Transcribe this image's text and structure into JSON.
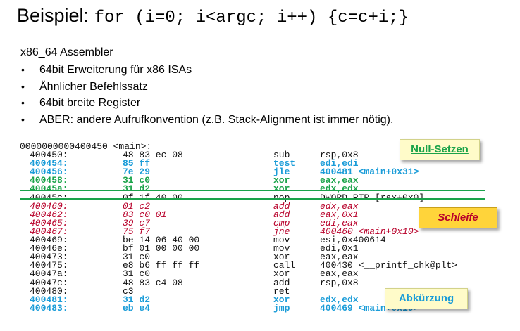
{
  "title": {
    "prefix": "Beispiel:",
    "code": "for (i=0; i<argc; i++) {c=c+i;}"
  },
  "subtitle": "x86_64 Assembler",
  "bullets": [
    "64bit Erweiterung für x86 ISAs",
    "Ähnlicher Befehlssatz",
    "64bit breite Register",
    "ABER: andere Aufrufkonvention (z.B. Stack-Alignment ist immer nötig),"
  ],
  "bullet_glyph": "•",
  "listing": {
    "header": "0000000000400450 <main>:",
    "rows": [
      {
        "addr": "400450:",
        "bytes": "48 83 ec 08",
        "mnemonic": "sub",
        "operands": "rsp,0x8",
        "style": "black"
      },
      {
        "addr": "400454:",
        "bytes": "85 ff",
        "mnemonic": "test",
        "operands": "edi,edi",
        "style": "blue"
      },
      {
        "addr": "400456:",
        "bytes": "7e 29",
        "mnemonic": "jle",
        "operands": "400481 <main+0x31>",
        "style": "blue"
      },
      {
        "addr": "400458:",
        "bytes": "31 c0",
        "mnemonic": "xor",
        "operands": "eax,eax",
        "style": "green"
      },
      {
        "addr": "40045a:",
        "bytes": "31 d2",
        "mnemonic": "xor",
        "operands": "edx,edx",
        "style": "green"
      },
      {
        "addr": "40045c:",
        "bytes": "0f 1f 40 00",
        "mnemonic": "nop",
        "operands": "DWORD PTR [rax+0x0]",
        "style": "black"
      },
      {
        "addr": "400460:",
        "bytes": "01 c2",
        "mnemonic": "add",
        "operands": "edx,eax",
        "style": "red"
      },
      {
        "addr": "400462:",
        "bytes": "83 c0 01",
        "mnemonic": "add",
        "operands": "eax,0x1",
        "style": "red"
      },
      {
        "addr": "400465:",
        "bytes": "39 c7",
        "mnemonic": "cmp",
        "operands": "edi,eax",
        "style": "red"
      },
      {
        "addr": "400467:",
        "bytes": "75 f7",
        "mnemonic": "jne",
        "operands": "400460 <main+0x10>",
        "style": "red"
      },
      {
        "addr": "400469:",
        "bytes": "be 14 06 40 00",
        "mnemonic": "mov",
        "operands": "esi,0x400614",
        "style": "black"
      },
      {
        "addr": "40046e:",
        "bytes": "bf 01 00 00 00",
        "mnemonic": "mov",
        "operands": "edi,0x1",
        "style": "black"
      },
      {
        "addr": "400473:",
        "bytes": "31 c0",
        "mnemonic": "xor",
        "operands": "eax,eax",
        "style": "black"
      },
      {
        "addr": "400475:",
        "bytes": "e8 b6 ff ff ff",
        "mnemonic": "call",
        "operands": "400430 <__printf_chk@plt>",
        "style": "black"
      },
      {
        "addr": "40047a:",
        "bytes": "31 c0",
        "mnemonic": "xor",
        "operands": "eax,eax",
        "style": "black"
      },
      {
        "addr": "40047c:",
        "bytes": "48 83 c4 08",
        "mnemonic": "add",
        "operands": "rsp,0x8",
        "style": "black"
      },
      {
        "addr": "400480:",
        "bytes": "c3",
        "mnemonic": "ret",
        "operands": "",
        "style": "black"
      },
      {
        "addr": "400481:",
        "bytes": "31 d2",
        "mnemonic": "xor",
        "operands": "edx,edx",
        "style": "blue"
      },
      {
        "addr": "400483:",
        "bytes": "eb e4",
        "mnemonic": "jmp",
        "operands": "400469 <main+0x19>",
        "style": "blue"
      }
    ]
  },
  "labels": {
    "null_setzen": "Null-Setzen",
    "schleife": "Schleife",
    "abkuerzung": "Abkürzung"
  },
  "colors": {
    "blue": "#1a9cd8",
    "green": "#1aa34a",
    "red": "#b8002a",
    "loop_box": "#ffd43a",
    "note_box": "#fffbc9"
  }
}
